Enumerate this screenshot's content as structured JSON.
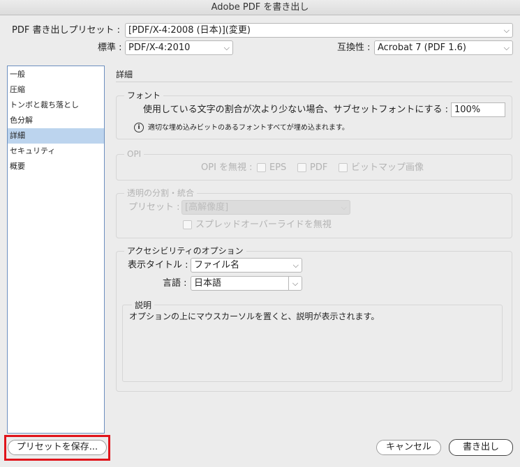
{
  "window": {
    "title": "Adobe PDF を書き出し"
  },
  "header": {
    "preset_label": "PDF 書き出しプリセット :",
    "preset_value": "[PDF/X-4:2008 (日本)](変更)",
    "standard_label": "標準 :",
    "standard_value": "PDF/X-4:2010",
    "compat_label": "互換性 :",
    "compat_value": "Acrobat 7 (PDF 1.6)"
  },
  "sidebar": {
    "items": [
      {
        "label": "一般",
        "selected": false
      },
      {
        "label": "圧縮",
        "selected": false
      },
      {
        "label": "トンボと裁ち落とし",
        "selected": false
      },
      {
        "label": "色分解",
        "selected": false
      },
      {
        "label": "詳細",
        "selected": true
      },
      {
        "label": "セキュリティ",
        "selected": false
      },
      {
        "label": "概要",
        "selected": false
      }
    ]
  },
  "main": {
    "section_title": "詳細",
    "font_group": {
      "title": "フォント",
      "subset_label": "使用している文字の割合が次より少ない場合、サブセットフォントにする :",
      "subset_value": "100%",
      "info_text": "適切な埋め込みビットのあるフォントすべてが埋め込まれます。"
    },
    "opi_group": {
      "title": "OPI",
      "omit_label": "OPI を無視 :",
      "eps_label": "EPS",
      "pdf_label": "PDF",
      "bitmap_label": "ビットマップ画像"
    },
    "transparency_group": {
      "title": "透明の分割・統合",
      "preset_label": "プリセット :",
      "preset_value": "[高解像度]",
      "spread_override_label": "スプレッドオーバーライドを無視"
    },
    "accessibility_group": {
      "title": "アクセシビリティのオプション",
      "display_title_label": "表示タイトル :",
      "display_title_value": "ファイル名",
      "language_label": "言語 :",
      "language_value": "日本語"
    },
    "description": {
      "title": "説明",
      "text": "オプションの上にマウスカーソルを置くと、説明が表示されます。"
    }
  },
  "footer": {
    "save_preset_label": "プリセットを保存...",
    "cancel_label": "キャンセル",
    "export_label": "書き出し"
  },
  "colors": {
    "selection": "#bcd4ee",
    "highlight_outline": "#e0141b"
  }
}
